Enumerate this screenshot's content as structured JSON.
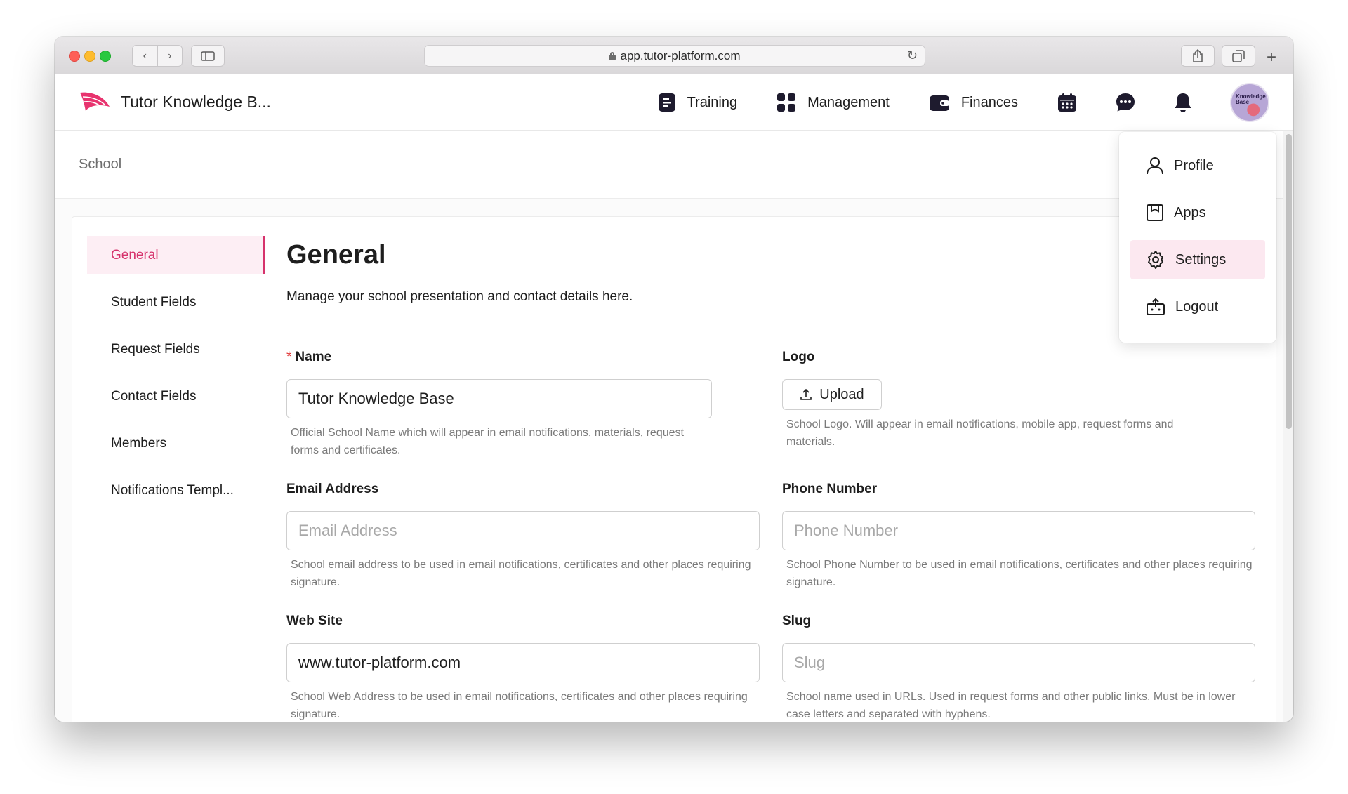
{
  "browser": {
    "url": "app.tutor-platform.com"
  },
  "app": {
    "brand_name": "Tutor Knowledge B...",
    "nav": [
      {
        "label": "Training",
        "icon": "document-list-icon"
      },
      {
        "label": "Management",
        "icon": "grid-icon"
      },
      {
        "label": "Finances",
        "icon": "wallet-icon"
      }
    ],
    "icons": [
      "calendar-icon",
      "chat-icon",
      "bell-icon"
    ],
    "avatar_text": "Knowledge Base",
    "accent_color": "#d6336c"
  },
  "breadcrumb": "School",
  "side_menu": [
    {
      "label": "General",
      "active": true
    },
    {
      "label": "Student Fields"
    },
    {
      "label": "Request Fields"
    },
    {
      "label": "Contact Fields"
    },
    {
      "label": "Members"
    },
    {
      "label": "Notifications Templ..."
    }
  ],
  "main": {
    "title": "General",
    "description": "Manage your school presentation and contact details here."
  },
  "fields": {
    "name": {
      "label": "Name",
      "required_mark": "*",
      "value": "Tutor Knowledge Base",
      "help": "Official School Name which will appear in email notifications, materials, request forms and certificates."
    },
    "logo": {
      "label": "Logo",
      "button": "Upload",
      "help": "School Logo. Will appear in email notifications, mobile app, request forms and materials."
    },
    "email": {
      "label": "Email Address",
      "placeholder": "Email Address",
      "value": "",
      "help": "School email address to be used in email notifications, certificates and other places requiring signature."
    },
    "phone": {
      "label": "Phone Number",
      "placeholder": "Phone Number",
      "value": "",
      "help": "School Phone Number to be used in email notifications, certificates and other places requiring signature."
    },
    "website": {
      "label": "Web Site",
      "value": "www.tutor-platform.com",
      "help": "School Web Address to be used in email notifications, certificates and other places requiring signature."
    },
    "slug": {
      "label": "Slug",
      "placeholder": "Slug",
      "value": "",
      "help": "School name used in URLs. Used in request forms and other public links. Must be in lower case letters and separated with hyphens."
    }
  },
  "dropdown": [
    {
      "label": "Profile",
      "icon": "user-icon"
    },
    {
      "label": "Apps",
      "icon": "apps-icon"
    },
    {
      "label": "Settings",
      "icon": "gear-icon",
      "active": true
    },
    {
      "label": "Logout",
      "icon": "logout-icon"
    }
  ]
}
